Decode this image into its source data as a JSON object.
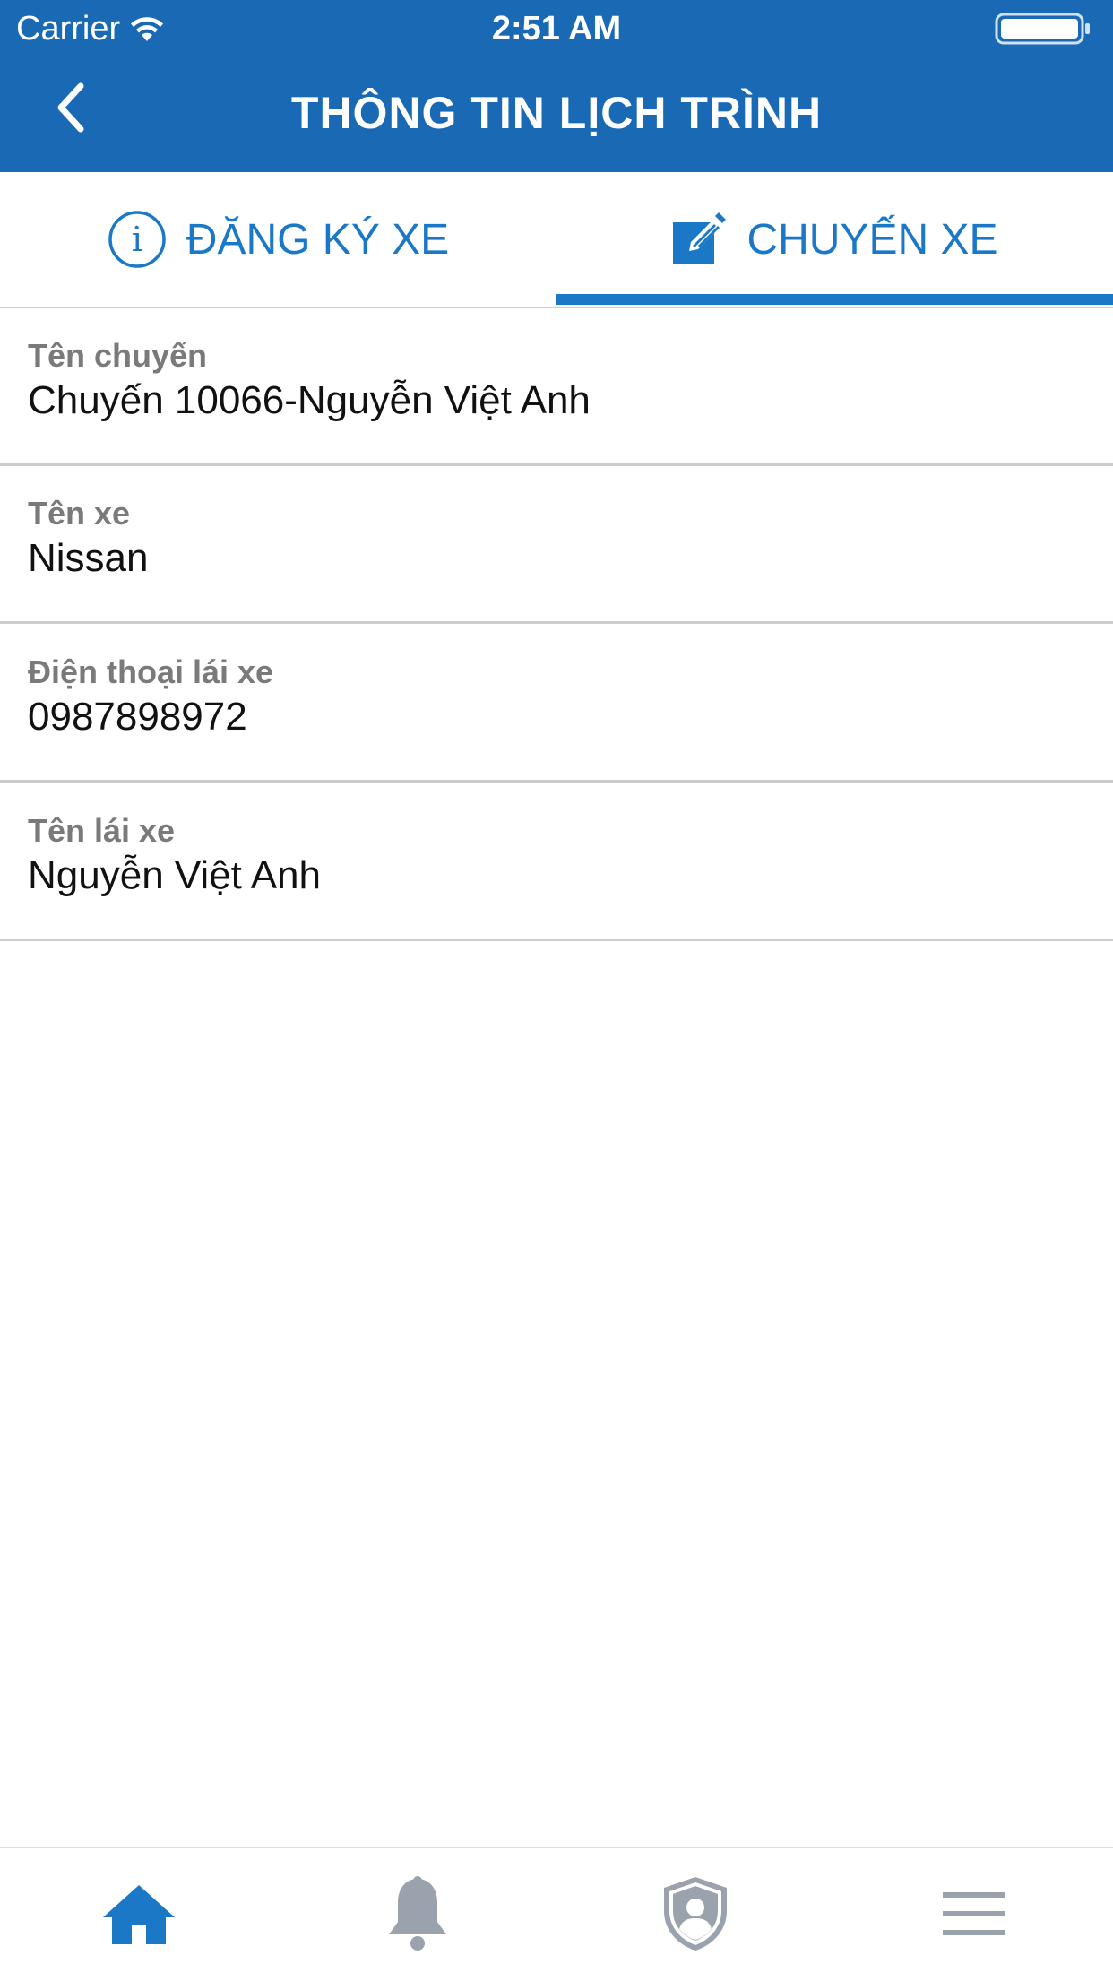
{
  "status_bar": {
    "carrier": "Carrier",
    "time": "2:51 AM"
  },
  "header": {
    "title": "THÔNG TIN LỊCH TRÌNH"
  },
  "tabs": [
    {
      "label": "ĐĂNG KÝ XE",
      "icon": "info-icon",
      "active": false
    },
    {
      "label": "CHUYẾN XE",
      "icon": "edit-icon",
      "active": true
    }
  ],
  "fields": [
    {
      "label": "Tên chuyến",
      "value": "Chuyến 10066-Nguyễn Việt Anh"
    },
    {
      "label": "Tên xe",
      "value": "Nissan"
    },
    {
      "label": "Điện thoại lái xe",
      "value": "0987898972"
    },
    {
      "label": "Tên lái xe",
      "value": "Nguyễn Việt Anh"
    }
  ],
  "bottom_nav": [
    {
      "icon": "home-icon",
      "active": true
    },
    {
      "icon": "bell-icon",
      "active": false
    },
    {
      "icon": "shield-user-icon",
      "active": false
    },
    {
      "icon": "menu-icon",
      "active": false
    }
  ],
  "colors": {
    "primary": "#1a69b5",
    "accent": "#1b78c7",
    "inactive": "#9aa3ad"
  }
}
